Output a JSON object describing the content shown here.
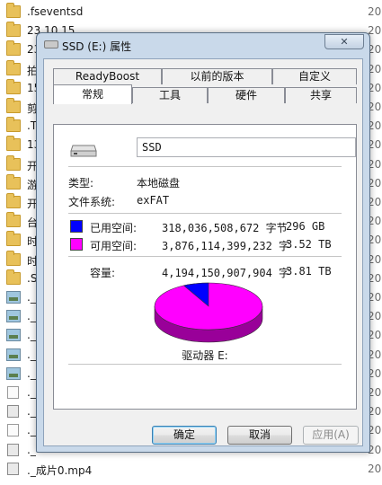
{
  "background_files": [
    {
      "name": ".fseventsd",
      "date": "20",
      "icon": "folder"
    },
    {
      "name": "23.10.15",
      "date": "20",
      "icon": "folder"
    },
    {
      "name": "23",
      "date": "20",
      "icon": "folder"
    },
    {
      "name": "拍",
      "date": "20",
      "icon": "folder"
    },
    {
      "name": "15",
      "date": "20",
      "icon": "folder"
    },
    {
      "name": "剪",
      "date": "20",
      "icon": "folder"
    },
    {
      "name": ".T",
      "date": "20",
      "icon": "folder"
    },
    {
      "name": "13",
      "date": "20",
      "icon": "folder"
    },
    {
      "name": "开",
      "date": "20",
      "icon": "folder"
    },
    {
      "name": "游",
      "date": "20",
      "icon": "folder"
    },
    {
      "name": "开",
      "date": "20",
      "icon": "folder"
    },
    {
      "name": "台",
      "date": "20",
      "icon": "folder"
    },
    {
      "name": "时",
      "date": "20",
      "icon": "folder"
    },
    {
      "name": "时",
      "date": "20",
      "icon": "folder"
    },
    {
      "name": ".S",
      "date": "20",
      "icon": "folder"
    },
    {
      "name": "._",
      "date": "20",
      "icon": "image"
    },
    {
      "name": "._",
      "date": "20",
      "icon": "image"
    },
    {
      "name": "._",
      "date": "20",
      "icon": "image"
    },
    {
      "name": "._",
      "date": "20",
      "icon": "image"
    },
    {
      "name": "._",
      "date": "20",
      "icon": "image"
    },
    {
      "name": "._",
      "date": "20",
      "icon": "file"
    },
    {
      "name": "._",
      "date": "20",
      "icon": "media"
    },
    {
      "name": "._",
      "date": "20",
      "icon": "file"
    },
    {
      "name": "._",
      "date": "20",
      "icon": "media"
    },
    {
      "name": "._成片0.mp4",
      "date": "20",
      "icon": "media"
    }
  ],
  "dialog": {
    "title": "SSD (E:) 属性",
    "close_glyph": "✕",
    "tabs_top": [
      "ReadyBoost",
      "以前的版本",
      "自定义"
    ],
    "tabs_bottom": [
      "常规",
      "工具",
      "硬件",
      "共享"
    ],
    "active_tab": "常规",
    "general": {
      "name_value": "SSD",
      "type_label": "类型:",
      "type_value": "本地磁盘",
      "fs_label": "文件系统:",
      "fs_value": "exFAT",
      "used_label": "已用空间:",
      "used_bytes": "318,036,508,672 字节",
      "used_size": "296 GB",
      "free_label": "可用空间:",
      "free_bytes": "3,876,114,399,232 字",
      "free_size": "3.52 TB",
      "capacity_label": "容量:",
      "capacity_bytes": "4,194,150,907,904 字",
      "capacity_size": "3.81 TB",
      "drive_label": "驱动器 E:",
      "used_color": "#0000ff",
      "free_color": "#ff00ff",
      "used_fraction": 0.0758
    },
    "buttons": {
      "ok": "确定",
      "cancel": "取消",
      "apply": "应用(A)"
    }
  }
}
